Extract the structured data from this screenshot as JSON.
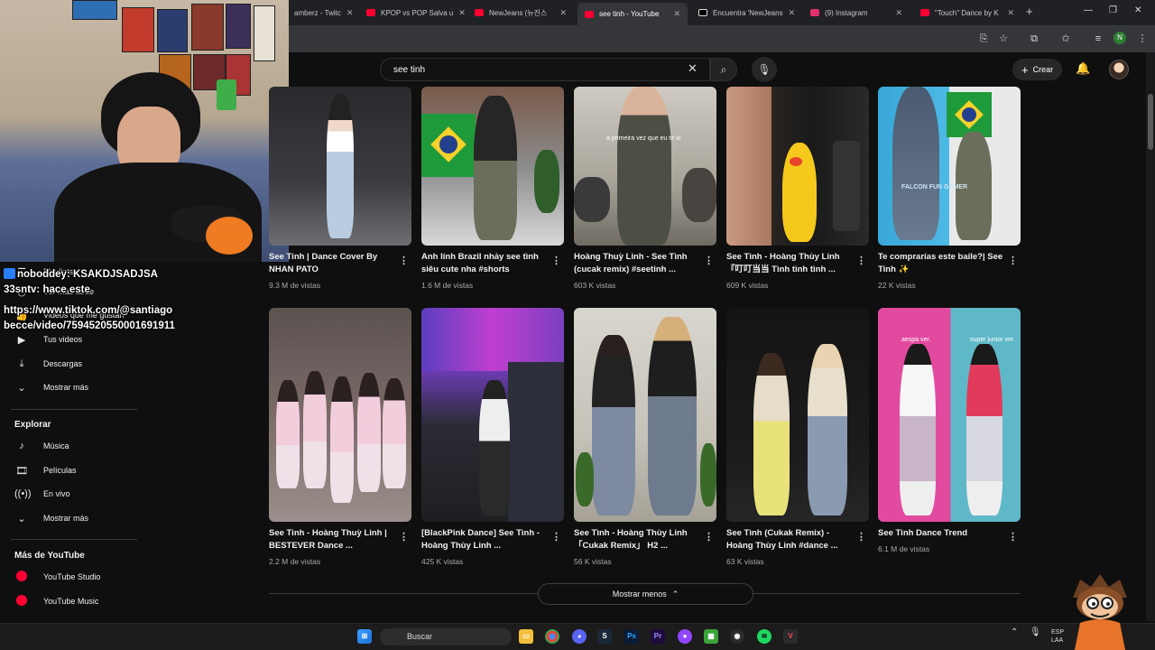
{
  "browser": {
    "tabs": [
      {
        "label": "amberz - Twitc",
        "color": "#9146ff"
      },
      {
        "label": "KPOP vs POP Salva u",
        "color": "#ff0033"
      },
      {
        "label": "NewJeans (뉴진스",
        "color": "#ff0033"
      },
      {
        "label": "see tinh - YouTube",
        "color": "#ff0033"
      },
      {
        "label": "Encuentra 'NewJeans",
        "color": "#000000"
      },
      {
        "label": "(9) Instagram",
        "color": "#e1306c"
      },
      {
        "label": "\"Touch\" Dance by K",
        "color": "#ff0033"
      }
    ],
    "new_tab": "+",
    "profile_initial": "N"
  },
  "header": {
    "search_value": "see tinh",
    "create_label": "Crear"
  },
  "chat": {
    "lines": [
      {
        "user": "noboddey:",
        "text": "KSAKDJSADJSA"
      },
      {
        "user": "33sntv:",
        "text": "hace este"
      },
      {
        "user": "",
        "text": "https://www.tiktok.com/@santiago"
      },
      {
        "user": "",
        "text": "becce/video/7594520550001691911"
      }
    ]
  },
  "sidebar": {
    "top_items": [
      {
        "label": "Playlists",
        "icon": "playlist-icon"
      },
      {
        "label": "Ver más tarde",
        "icon": "clock-icon"
      },
      {
        "label": "Videos que me gustan",
        "icon": "like-icon"
      },
      {
        "label": "Tus videos",
        "icon": "video-icon"
      },
      {
        "label": "Descargas",
        "icon": "download-icon"
      },
      {
        "label": "Mostrar más",
        "icon": "chevron-down-icon"
      }
    ],
    "explore_heading": "Explorar",
    "explore_items": [
      {
        "label": "Música",
        "icon": "music-icon"
      },
      {
        "label": "Películas",
        "icon": "film-icon"
      },
      {
        "label": "En vivo",
        "icon": "live-icon"
      },
      {
        "label": "Mostrar más",
        "icon": "chevron-down-icon"
      }
    ],
    "more_heading": "Más de YouTube",
    "more_items": [
      {
        "label": "YouTube Studio",
        "icon": "youtube-studio-icon"
      },
      {
        "label": "YouTube Music",
        "icon": "youtube-music-icon"
      }
    ]
  },
  "videos": [
    {
      "title": "See Tinh | Dance Cover By NHAN PATO",
      "views": "9.3 M de vistas"
    },
    {
      "title": "Anh lính Brazil nhảy see tình siêu cute nha #shorts",
      "views": "1.6 M de vistas"
    },
    {
      "title": "Hoàng Thuỳ Linh - See Tình (cucak remix) #seetinh ...",
      "views": "603 K vistas",
      "overlay": "a primeira vez que eu te vi"
    },
    {
      "title": "See Tình - Hoàng Thùy Linh 『叮叮当当 Tình tình tình ...",
      "views": "609 K vistas"
    },
    {
      "title": "Te comprarías este baile?| See Tinh ✨",
      "views": "22 K vistas",
      "overlay": "FALCON FUN GAMER"
    },
    {
      "title": "See Tinh - Hoàng Thuỳ Linh | BESTEVER Dance ...",
      "views": "2.2 M de vistas"
    },
    {
      "title": "[BlackPink Dance] See Tình - Hoàng Thùy Linh ...",
      "views": "425 K vistas"
    },
    {
      "title": "See Tình - Hoàng Thùy Linh 「Cukak Remix」 H2 ...",
      "views": "56 K vistas"
    },
    {
      "title": "See Tình (Cukak Remix) - Hoàng Thùy Linh #dance ...",
      "views": "63 K vistas"
    },
    {
      "title": "See Tinh Dance Trend",
      "views": "6.1 M de vistas",
      "overlay_left": "aespa ver.",
      "overlay_right": "super junior ver."
    }
  ],
  "show_less_label": "Mostrar menos",
  "taskbar": {
    "search_label": "Buscar",
    "lang": "ESP",
    "lang2": "LAA"
  },
  "colors": {
    "background": "#0f0f0f",
    "youtube_red": "#ff0033",
    "chrome_dark": "#202124"
  }
}
